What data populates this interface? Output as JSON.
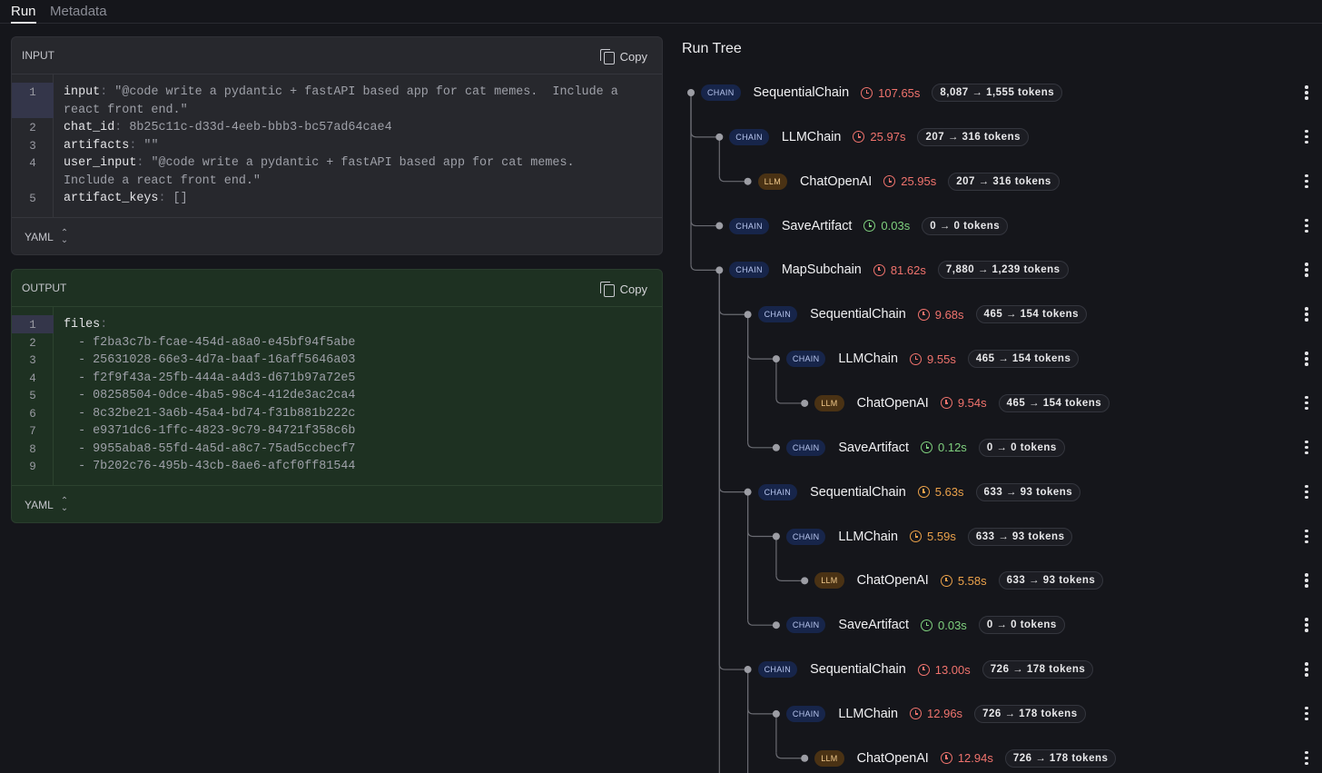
{
  "tabs": {
    "run": "Run",
    "metadata": "Metadata"
  },
  "input_panel": {
    "title": "INPUT",
    "copy_label": "Copy",
    "format_label": "YAML",
    "lines": [
      {
        "num": "1",
        "key": "input",
        "value": " \"@code write a pydantic + fastAPI based app for cat memes.  Include a"
      },
      {
        "num": "",
        "key": "",
        "value": "react front end.\""
      },
      {
        "num": "2",
        "key": "chat_id",
        "value": " 8b25c11c-d33d-4eeb-bbb3-bc57ad64cae4"
      },
      {
        "num": "3",
        "key": "artifacts",
        "value": " \"\""
      },
      {
        "num": "4",
        "key": "user_input",
        "value": " \"@code write a pydantic + fastAPI based app for cat memes."
      },
      {
        "num": "",
        "key": "",
        "value": "Include a react front end.\""
      },
      {
        "num": "5",
        "key": "artifact_keys",
        "value": " []"
      }
    ]
  },
  "output_panel": {
    "title": "OUTPUT",
    "copy_label": "Copy",
    "format_label": "YAML",
    "lines": [
      {
        "num": "1",
        "key": "files",
        "value": ""
      },
      {
        "num": "2",
        "key": "",
        "value": "  - f2ba3c7b-fcae-454d-a8a0-e45bf94f5abe"
      },
      {
        "num": "3",
        "key": "",
        "value": "  - 25631028-66e3-4d7a-baaf-16aff5646a03"
      },
      {
        "num": "4",
        "key": "",
        "value": "  - f2f9f43a-25fb-444a-a4d3-d671b97a72e5"
      },
      {
        "num": "5",
        "key": "",
        "value": "  - 08258504-0dce-4ba5-98c4-412de3ac2ca4"
      },
      {
        "num": "6",
        "key": "",
        "value": "  - 8c32be21-3a6b-45a4-bd74-f31b881b222c"
      },
      {
        "num": "7",
        "key": "",
        "value": "  - e9371dc6-1ffc-4823-9c79-84721f358c6b"
      },
      {
        "num": "8",
        "key": "",
        "value": "  - 9955aba8-55fd-4a5d-a8c7-75ad5ccbecf7"
      },
      {
        "num": "9",
        "key": "",
        "value": "  - 7b202c76-495b-43cb-8ae6-afcf0ff81544"
      }
    ]
  },
  "run_tree": {
    "title": "Run Tree",
    "colors": {
      "red": "#f0736d",
      "green": "#7fd07e",
      "orange": "#eaa14a",
      "chain_badge": "#17254a",
      "llm_badge": "#4a3214"
    },
    "nodes": [
      {
        "depth": 0,
        "type": "CHAIN",
        "name": "SequentialChain",
        "latency": "107.65s",
        "latency_color": "red",
        "tokens": "8,087 → 1,555 tokens"
      },
      {
        "depth": 1,
        "type": "CHAIN",
        "name": "LLMChain",
        "latency": "25.97s",
        "latency_color": "red",
        "tokens": "207 → 316 tokens"
      },
      {
        "depth": 2,
        "type": "LLM",
        "name": "ChatOpenAI",
        "latency": "25.95s",
        "latency_color": "red",
        "tokens": "207 → 316 tokens"
      },
      {
        "depth": 1,
        "type": "CHAIN",
        "name": "SaveArtifact",
        "latency": "0.03s",
        "latency_color": "green",
        "tokens": "0 → 0 tokens"
      },
      {
        "depth": 1,
        "type": "CHAIN",
        "name": "MapSubchain",
        "latency": "81.62s",
        "latency_color": "red",
        "tokens": "7,880 → 1,239 tokens"
      },
      {
        "depth": 2,
        "type": "CHAIN",
        "name": "SequentialChain",
        "latency": "9.68s",
        "latency_color": "red",
        "tokens": "465 → 154 tokens"
      },
      {
        "depth": 3,
        "type": "CHAIN",
        "name": "LLMChain",
        "latency": "9.55s",
        "latency_color": "red",
        "tokens": "465 → 154 tokens"
      },
      {
        "depth": 4,
        "type": "LLM",
        "name": "ChatOpenAI",
        "latency": "9.54s",
        "latency_color": "red",
        "tokens": "465 → 154 tokens"
      },
      {
        "depth": 3,
        "type": "CHAIN",
        "name": "SaveArtifact",
        "latency": "0.12s",
        "latency_color": "green",
        "tokens": "0 → 0 tokens"
      },
      {
        "depth": 2,
        "type": "CHAIN",
        "name": "SequentialChain",
        "latency": "5.63s",
        "latency_color": "orange",
        "tokens": "633 → 93 tokens"
      },
      {
        "depth": 3,
        "type": "CHAIN",
        "name": "LLMChain",
        "latency": "5.59s",
        "latency_color": "orange",
        "tokens": "633 → 93 tokens"
      },
      {
        "depth": 4,
        "type": "LLM",
        "name": "ChatOpenAI",
        "latency": "5.58s",
        "latency_color": "orange",
        "tokens": "633 → 93 tokens"
      },
      {
        "depth": 3,
        "type": "CHAIN",
        "name": "SaveArtifact",
        "latency": "0.03s",
        "latency_color": "green",
        "tokens": "0 → 0 tokens"
      },
      {
        "depth": 2,
        "type": "CHAIN",
        "name": "SequentialChain",
        "latency": "13.00s",
        "latency_color": "red",
        "tokens": "726 → 178 tokens"
      },
      {
        "depth": 3,
        "type": "CHAIN",
        "name": "LLMChain",
        "latency": "12.96s",
        "latency_color": "red",
        "tokens": "726 → 178 tokens"
      },
      {
        "depth": 4,
        "type": "LLM",
        "name": "ChatOpenAI",
        "latency": "12.94s",
        "latency_color": "red",
        "tokens": "726 → 178 tokens"
      }
    ]
  }
}
